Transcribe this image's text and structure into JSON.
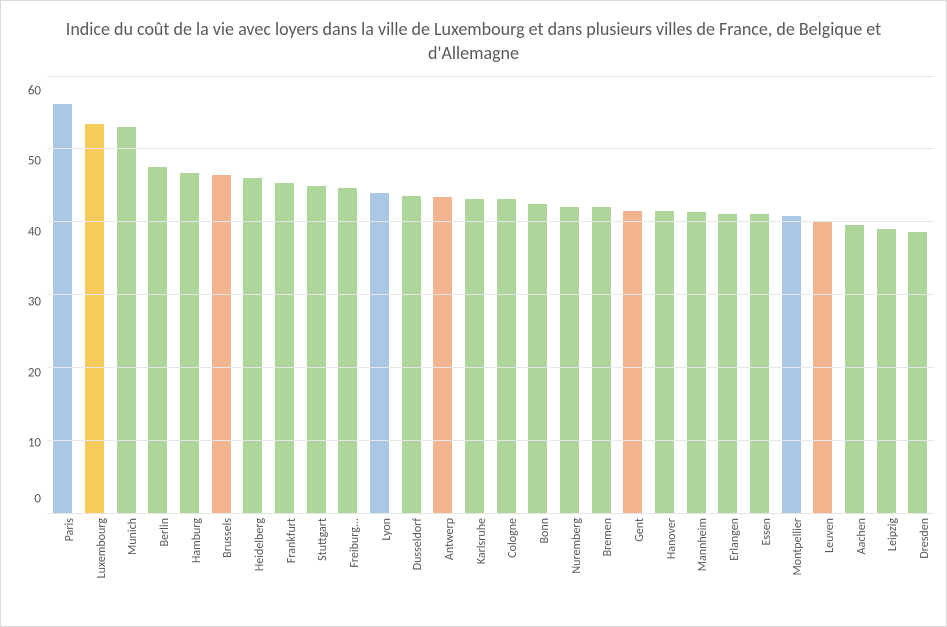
{
  "chart_data": {
    "type": "bar",
    "title": "Indice du coût de la vie avec loyers dans la ville de Luxembourg et dans plusieurs villes de France, de Belgique et d'Allemagne",
    "xlabel": "",
    "ylabel": "",
    "ylim": [
      0,
      60
    ],
    "yticks": [
      0,
      10,
      20,
      30,
      40,
      50,
      60
    ],
    "country_colors": {
      "France": "#aac8e4",
      "Luxembourg": "#f6cb5a",
      "Germany": "#aed69a",
      "Belgium": "#f2b48f"
    },
    "bars": [
      {
        "label": "Paris",
        "value": 56.1,
        "country": "France"
      },
      {
        "label": "Luxembourg",
        "value": 53.3,
        "country": "Luxembourg"
      },
      {
        "label": "Munich",
        "value": 53.0,
        "country": "Germany"
      },
      {
        "label": "Berlin",
        "value": 47.5,
        "country": "Germany"
      },
      {
        "label": "Hamburg",
        "value": 46.6,
        "country": "Germany"
      },
      {
        "label": "Brussels",
        "value": 46.4,
        "country": "Belgium"
      },
      {
        "label": "Heidelberg",
        "value": 45.9,
        "country": "Germany"
      },
      {
        "label": "Frankfurt",
        "value": 45.2,
        "country": "Germany"
      },
      {
        "label": "Stuttgart",
        "value": 44.8,
        "country": "Germany"
      },
      {
        "label": "Freiburg...",
        "value": 44.6,
        "country": "Germany"
      },
      {
        "label": "Lyon",
        "value": 43.9,
        "country": "France"
      },
      {
        "label": "Dusseldorf",
        "value": 43.5,
        "country": "Germany"
      },
      {
        "label": "Antwerp",
        "value": 43.3,
        "country": "Belgium"
      },
      {
        "label": "Karlsruhe",
        "value": 43.0,
        "country": "Germany"
      },
      {
        "label": "Cologne",
        "value": 43.0,
        "country": "Germany"
      },
      {
        "label": "Bonn",
        "value": 42.4,
        "country": "Germany"
      },
      {
        "label": "Nuremberg",
        "value": 42.0,
        "country": "Germany"
      },
      {
        "label": "Bremen",
        "value": 41.9,
        "country": "Germany"
      },
      {
        "label": "Gent",
        "value": 41.4,
        "country": "Belgium"
      },
      {
        "label": "Hanover",
        "value": 41.4,
        "country": "Germany"
      },
      {
        "label": "Mannheim",
        "value": 41.3,
        "country": "Germany"
      },
      {
        "label": "Erlangen",
        "value": 41.0,
        "country": "Germany"
      },
      {
        "label": "Essen",
        "value": 41.0,
        "country": "Germany"
      },
      {
        "label": "Montpellier",
        "value": 40.7,
        "country": "France"
      },
      {
        "label": "Leuven",
        "value": 39.9,
        "country": "Belgium"
      },
      {
        "label": "Aachen",
        "value": 39.5,
        "country": "Germany"
      },
      {
        "label": "Leipzig",
        "value": 38.9,
        "country": "Germany"
      },
      {
        "label": "Dresden",
        "value": 38.5,
        "country": "Germany"
      }
    ]
  }
}
